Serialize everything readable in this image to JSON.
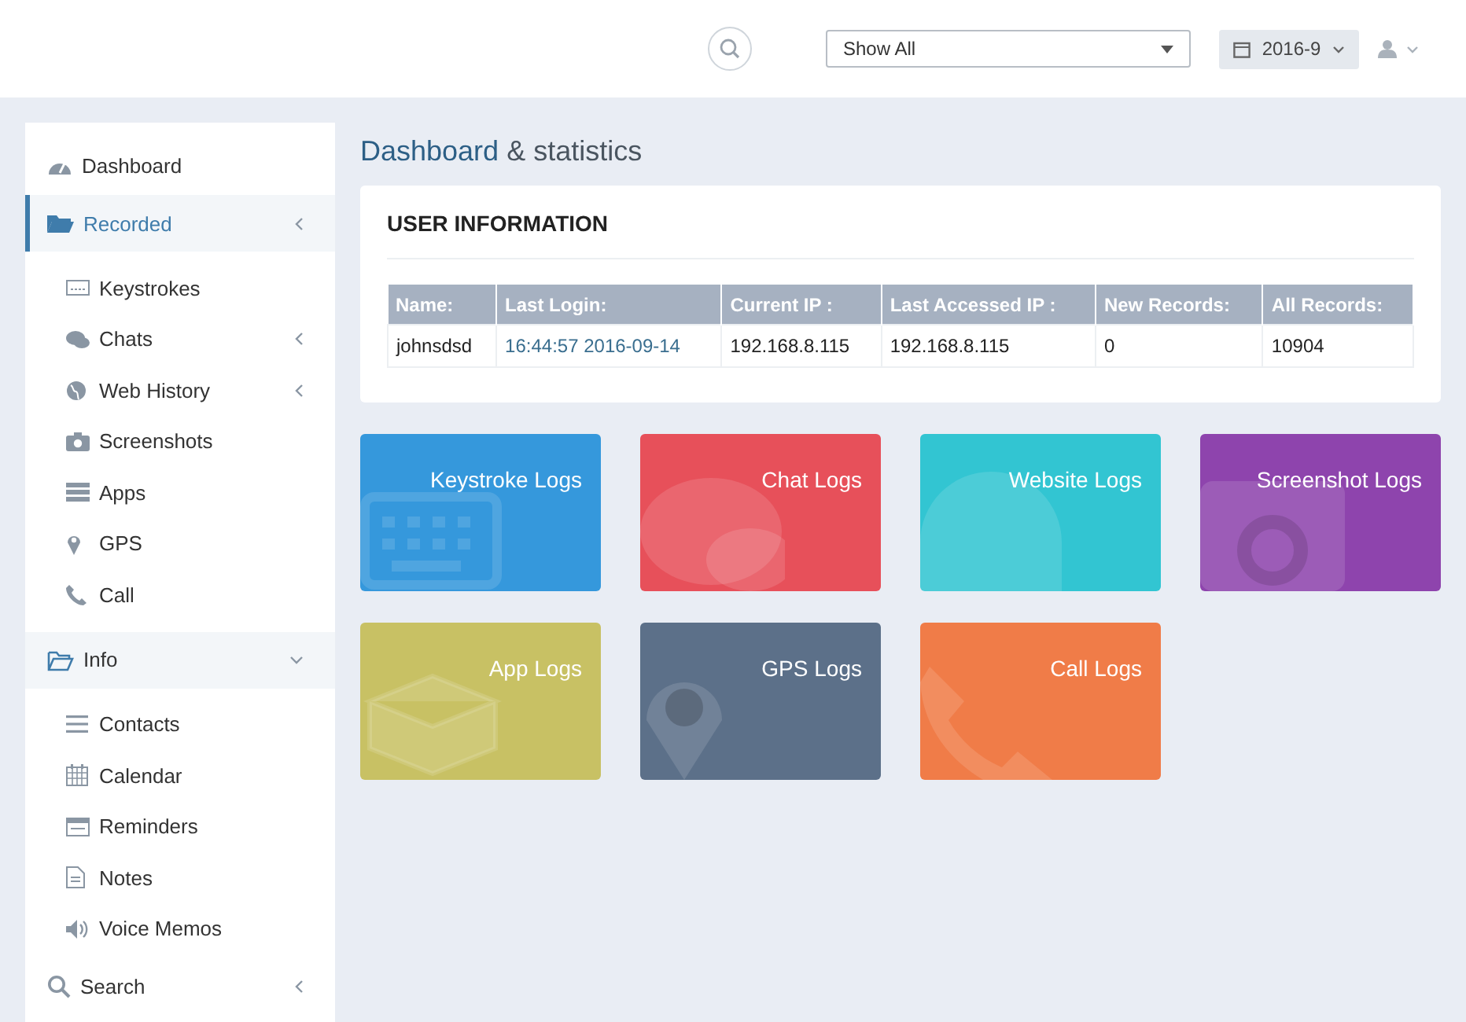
{
  "header": {
    "filter": {
      "value": "Show All"
    },
    "date": {
      "label": "2016-9"
    }
  },
  "sidebar": {
    "items": [
      {
        "label": "Dashboard",
        "selected": false
      },
      {
        "label": "Recorded",
        "selected": true,
        "expanded": false,
        "children": [
          {
            "label": "Keystrokes"
          },
          {
            "label": "Chats",
            "expanded": false
          },
          {
            "label": "Web History",
            "expanded": false
          },
          {
            "label": "Screenshots"
          },
          {
            "label": "Apps"
          },
          {
            "label": "GPS"
          },
          {
            "label": "Call"
          }
        ]
      },
      {
        "label": "Info",
        "selected": false,
        "expanded": true,
        "children": [
          {
            "label": "Contacts"
          },
          {
            "label": "Calendar"
          },
          {
            "label": "Reminders"
          },
          {
            "label": "Notes"
          },
          {
            "label": "Voice Memos"
          }
        ]
      },
      {
        "label": "Search",
        "selected": false,
        "expanded": false
      }
    ]
  },
  "page": {
    "title": "Dashboard",
    "title_suffix": "& statistics"
  },
  "user_info": {
    "title": "USER INFORMATION",
    "table": {
      "columns": [
        "Name:",
        "Last Login:",
        "Current IP :",
        "Last Accessed IP :",
        "New Records:",
        "All Records:"
      ],
      "rows": [
        [
          {
            "text": "johnsdsd",
            "kind": "text"
          },
          {
            "text": "16:44:57 2016-09-14",
            "kind": "link"
          },
          {
            "text": "192.168.8.115",
            "kind": "text"
          },
          {
            "text": "192.168.8.115",
            "kind": "text"
          },
          {
            "text": "0",
            "kind": "text"
          },
          {
            "text": "10904",
            "kind": "text"
          }
        ]
      ]
    }
  },
  "tiles": [
    {
      "label": "Keystroke Logs",
      "color": "#3598dc"
    },
    {
      "label": "Chat Logs",
      "color": "#e7505a"
    },
    {
      "label": "Website Logs",
      "color": "#32c5d2"
    },
    {
      "label": "Screenshot Logs",
      "color": "#8e44ad"
    },
    {
      "label": "App Logs",
      "color": "#c8c164"
    },
    {
      "label": "GPS Logs",
      "color": "#5c7089"
    },
    {
      "label": "Call Logs",
      "color": "#f07c48"
    }
  ]
}
